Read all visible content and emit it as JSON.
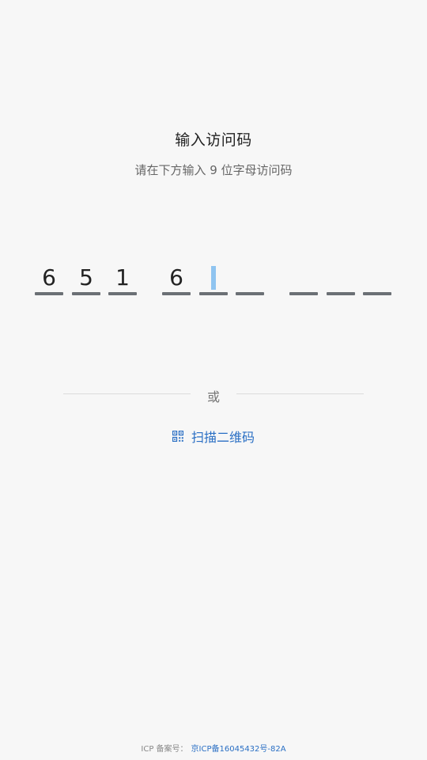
{
  "title": "输入访问码",
  "subtitle": "请在下方输入 9 位字母访问码",
  "code": {
    "slots": [
      "6",
      "5",
      "1",
      "6",
      "",
      "",
      "",
      "",
      ""
    ],
    "active_index": 4
  },
  "divider": {
    "or_label": "或"
  },
  "scan": {
    "label": "扫描二维码",
    "icon": "qr-code-icon"
  },
  "footer": {
    "icp_label": "ICP 备案号：",
    "icp_link": "京ICP备16045432号-82A"
  },
  "colors": {
    "accent": "#2a6fc4",
    "cursor": "#8fc4f0",
    "underline": "#6b7075",
    "background": "#f7f7f7"
  }
}
